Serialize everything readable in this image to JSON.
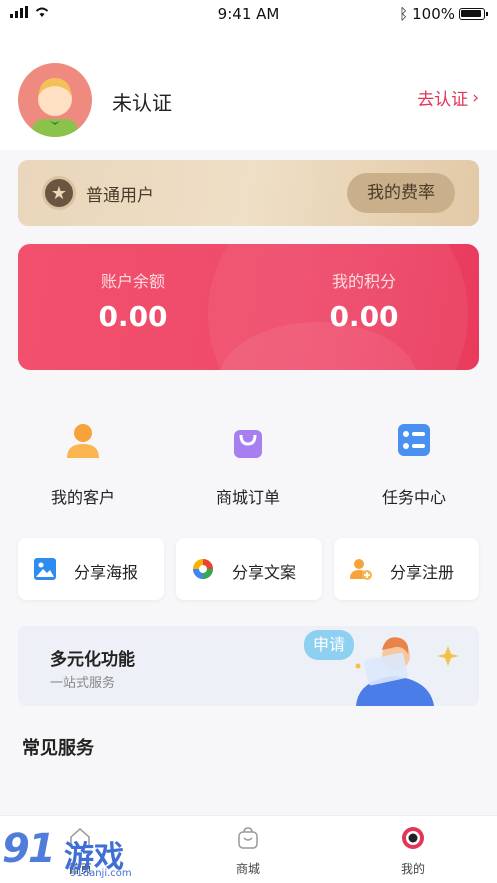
{
  "status_bar": {
    "time": "9:41 AM",
    "battery": "100%"
  },
  "profile": {
    "status": "未认证",
    "certify_link": "去认证"
  },
  "member": {
    "level": "普通用户",
    "rate_button": "我的费率"
  },
  "balance": {
    "account_label": "账户余额",
    "account_value": "0.00",
    "points_label": "我的积分",
    "points_value": "0.00"
  },
  "quick_actions": [
    {
      "label": "我的客户",
      "icon": "person-icon"
    },
    {
      "label": "商城订单",
      "icon": "shopping-bag-icon"
    },
    {
      "label": "任务中心",
      "icon": "task-list-icon"
    }
  ],
  "share_actions": [
    {
      "label": "分享海报",
      "icon": "image-icon"
    },
    {
      "label": "分享文案",
      "icon": "aperture-icon"
    },
    {
      "label": "分享注册",
      "icon": "add-user-icon"
    }
  ],
  "banner": {
    "title": "多元化功能",
    "subtitle": "一站式服务",
    "bubble": "申请"
  },
  "section": {
    "title": "常见服务"
  },
  "tabs": [
    {
      "label": "首页",
      "icon": "home-icon"
    },
    {
      "label": "商城",
      "icon": "bag-icon"
    },
    {
      "label": "我的",
      "icon": "profile-icon"
    }
  ],
  "watermark": {
    "number": "91",
    "name": "游戏",
    "url": "91danji.com"
  },
  "colors": {
    "accent": "#e3345a",
    "card_red": "#ef4a6a",
    "member_gold": "#e9d6bb"
  }
}
